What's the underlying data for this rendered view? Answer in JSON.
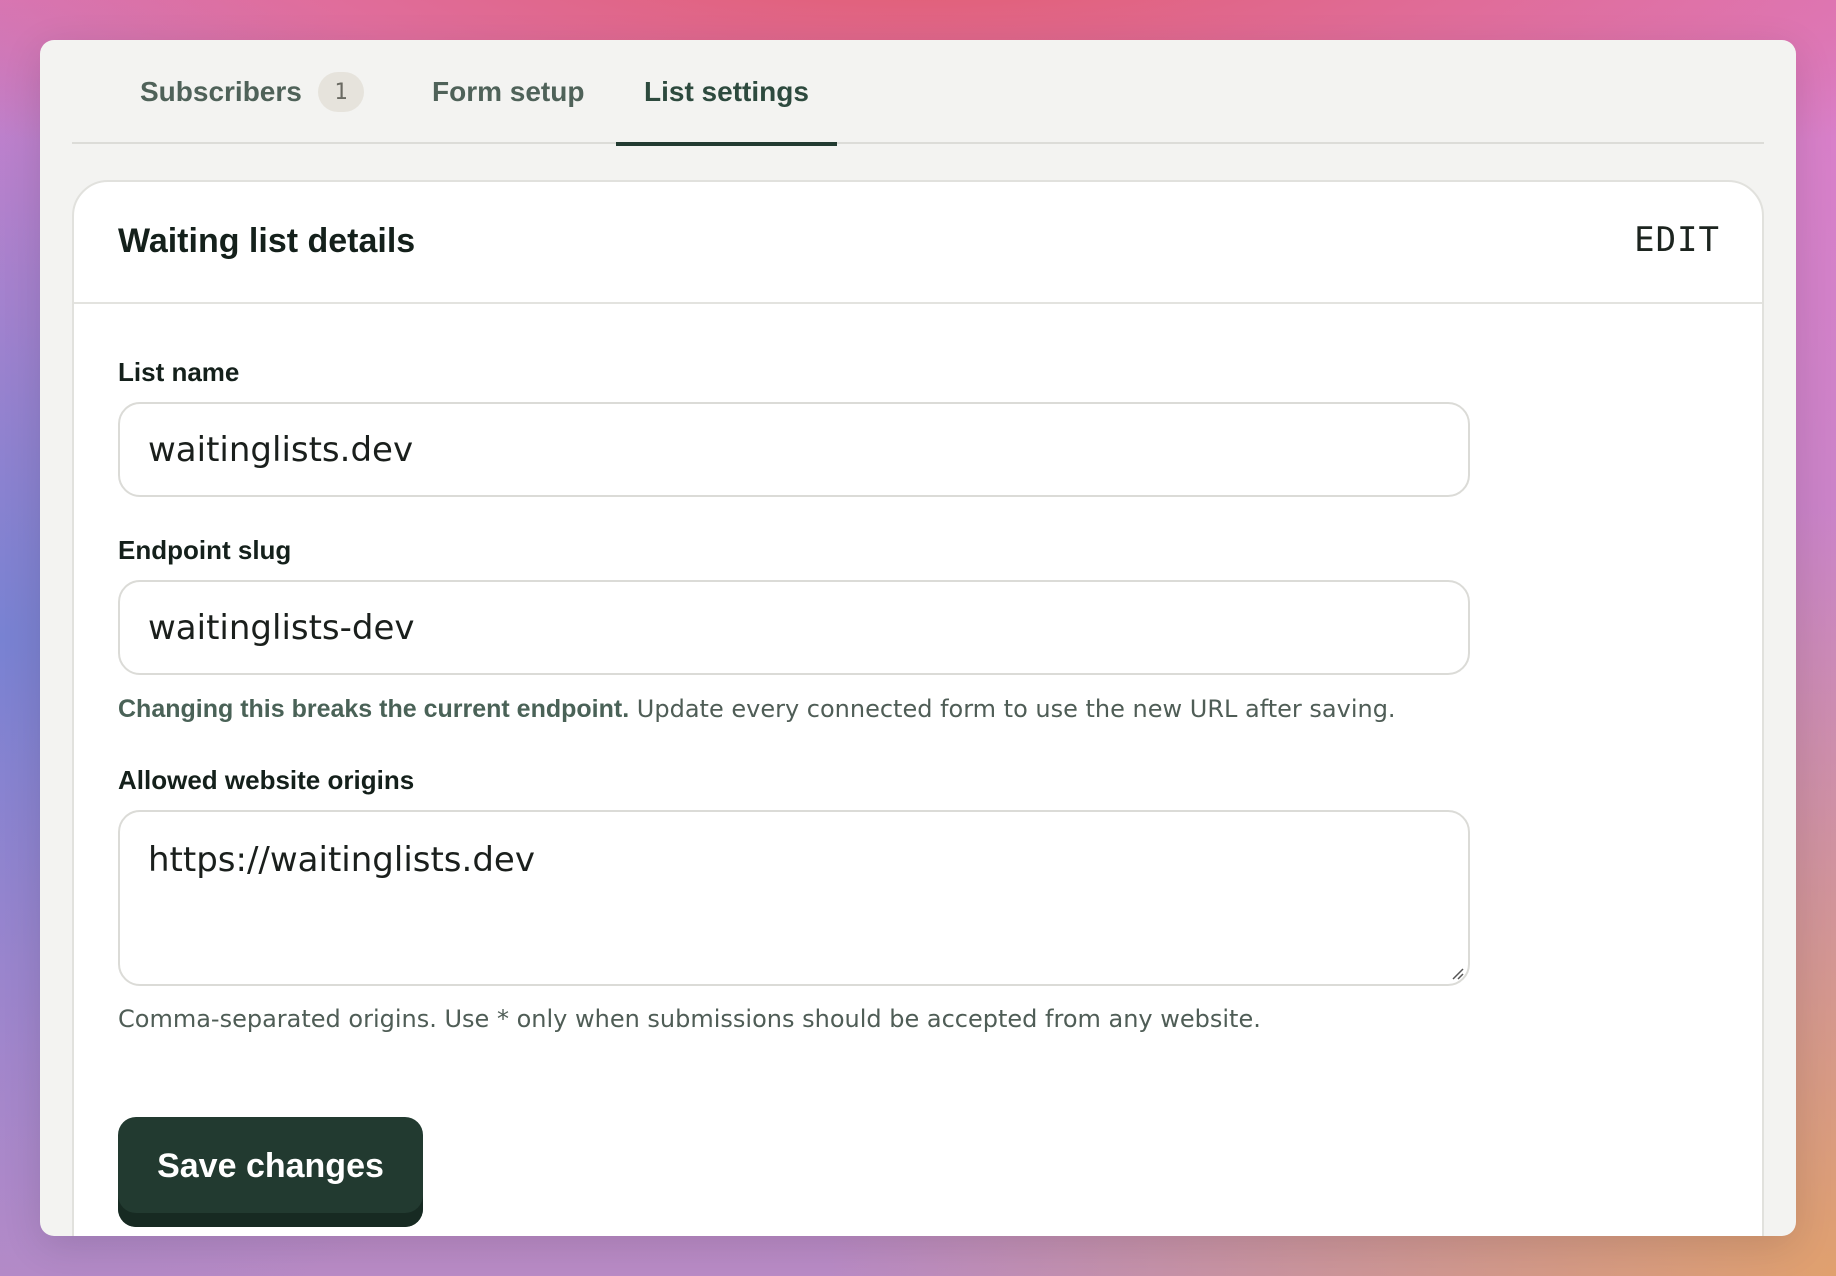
{
  "tabs": [
    {
      "label": "Subscribers",
      "badge": "1"
    },
    {
      "label": "Form setup"
    },
    {
      "label": "List settings",
      "active": true
    }
  ],
  "card": {
    "title": "Waiting list details",
    "edit_label": "EDIT"
  },
  "fields": {
    "list_name": {
      "label": "List name",
      "value": "waitinglists.dev"
    },
    "endpoint_slug": {
      "label": "Endpoint slug",
      "value": "waitinglists-dev",
      "help_bold": "Changing this breaks the current endpoint.",
      "help_text": " Update every connected form to use the new URL after saving."
    },
    "allowed_origins": {
      "label": "Allowed website origins",
      "value": "https://waitinglists.dev",
      "help_text": "Comma-separated origins. Use * only when submissions should be accepted from any website."
    }
  },
  "save_label": "Save changes",
  "colors": {
    "primary": "#223a30",
    "active_tab": "#2d4a3e",
    "text": "#14201b"
  }
}
